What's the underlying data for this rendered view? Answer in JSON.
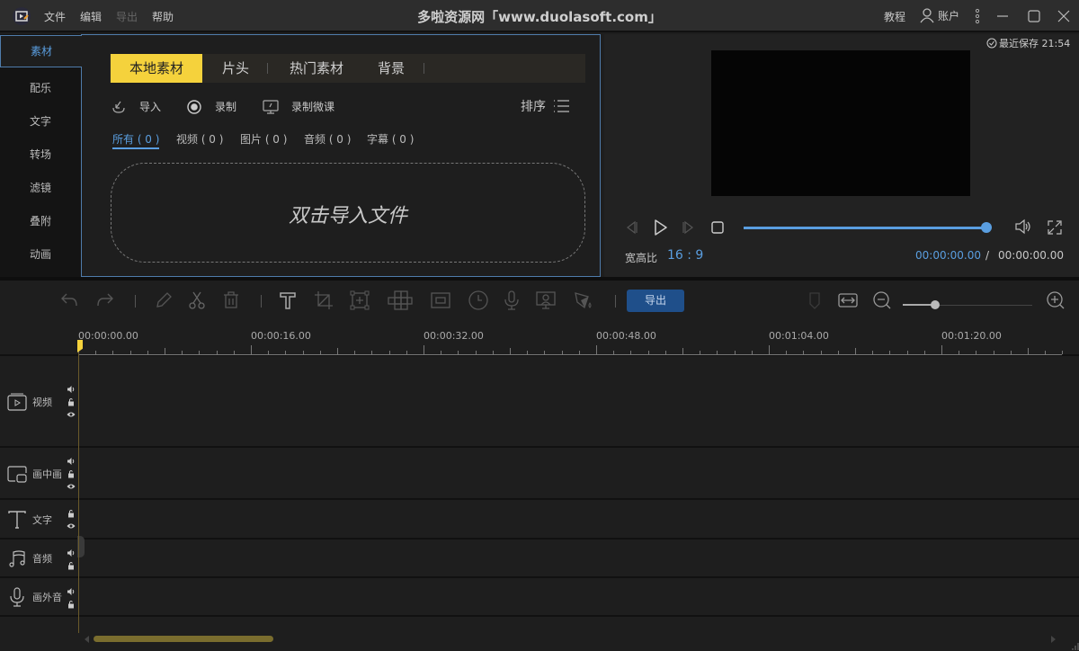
{
  "titlebar": {
    "app_icon": "video-editor-logo-icon",
    "menus": [
      {
        "label": "文件",
        "enabled": true
      },
      {
        "label": "编辑",
        "enabled": true
      },
      {
        "label": "导出",
        "enabled": false
      },
      {
        "label": "帮助",
        "enabled": true
      }
    ],
    "title": "多啦资源网「www.duolasoft.com」",
    "tutorial": "教程",
    "account": "账户",
    "window_controls": [
      "more-icon",
      "minimize-icon",
      "maximize-icon",
      "close-icon"
    ]
  },
  "sidebar": {
    "items": [
      {
        "label": "素材",
        "active": true
      },
      {
        "label": "配乐"
      },
      {
        "label": "文字"
      },
      {
        "label": "转场"
      },
      {
        "label": "滤镜"
      },
      {
        "label": "叠附"
      },
      {
        "label": "动画"
      }
    ]
  },
  "media": {
    "tabs": [
      {
        "label": "本地素材",
        "active": true
      },
      {
        "label": "片头"
      },
      {
        "label": "热门素材"
      },
      {
        "label": "背景"
      }
    ],
    "actions": [
      {
        "label": "导入",
        "icon": "import-icon"
      },
      {
        "label": "录制",
        "icon": "record-icon"
      },
      {
        "label": "录制微课",
        "icon": "screen-record-icon"
      }
    ],
    "sort_label": "排序",
    "filters": [
      {
        "label": "所有 ( 0 )",
        "active": true
      },
      {
        "label": "视频 ( 0 )"
      },
      {
        "label": "图片 ( 0 )"
      },
      {
        "label": "音频 ( 0 )"
      },
      {
        "label": "字幕 ( 0 )"
      }
    ],
    "dropzone_text": "双击导入文件"
  },
  "preview": {
    "last_saved": "最近保存 21:54",
    "aspect_label": "宽高比",
    "aspect_value": "16 : 9",
    "current_time": "00:00:00.00",
    "separator": "/",
    "total_time": "00:00:00.00",
    "progress_percent": 100
  },
  "toolbar": {
    "export_label": "导出",
    "zoom_level_percent": 25,
    "accent": "#1f4f8a"
  },
  "timeline": {
    "ruler_labels": [
      "00:00:00.00",
      "00:00:16.00",
      "00:00:32.00",
      "00:00:48.00",
      "00:01:04.00",
      "00:01:20.00"
    ],
    "tracks": [
      {
        "label": "视频",
        "icon": "video-track-icon",
        "controls": [
          "volume-icon",
          "lock-icon",
          "eye-icon"
        ]
      },
      {
        "label": "画中画",
        "icon": "pip-track-icon",
        "controls": [
          "volume-icon",
          "lock-icon",
          "eye-icon"
        ]
      },
      {
        "label": "文字",
        "icon": "text-track-icon",
        "controls": [
          "lock-icon",
          "eye-icon"
        ]
      },
      {
        "label": "音频",
        "icon": "music-track-icon",
        "controls": [
          "volume-icon",
          "lock-icon"
        ]
      },
      {
        "label": "画外音",
        "icon": "mic-track-icon",
        "controls": [
          "volume-icon",
          "lock-icon"
        ]
      }
    ]
  },
  "colors": {
    "accent_blue": "#5a9ee0",
    "accent_yellow": "#f5d23c",
    "background": "#1e1e1e"
  }
}
